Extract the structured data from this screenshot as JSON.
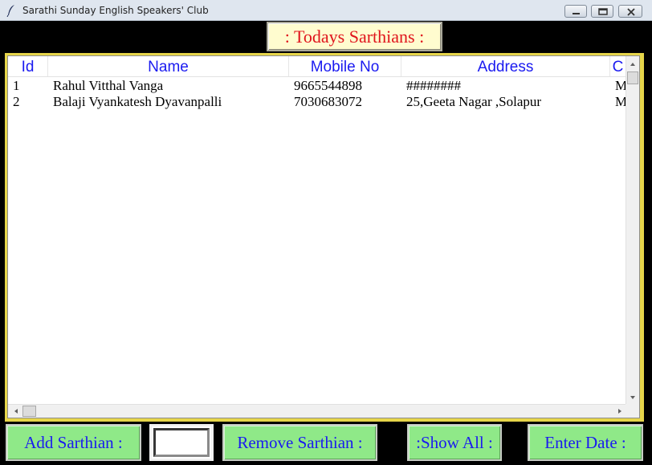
{
  "window": {
    "title": "Sarathi Sunday English Speakers' Club",
    "app_icon": "feather-icon",
    "controls": [
      "minimize-icon",
      "maximize-icon",
      "close-icon"
    ]
  },
  "header": {
    "title": ": Todays Sarthians :"
  },
  "table": {
    "columns": {
      "id": "Id",
      "name": "Name",
      "mobile": "Mobile No",
      "address": "Address",
      "extra": "C"
    },
    "rows": [
      {
        "id": "1",
        "name": "Rahul Vitthal Vanga",
        "mobile": "9665544898",
        "address": "########",
        "extra": "M"
      },
      {
        "id": "2",
        "name": "Balaji Vyankatesh Dyavanpalli",
        "mobile": "7030683072",
        "address": "25,Geeta Nagar ,Solapur",
        "extra": "M"
      }
    ]
  },
  "footer": {
    "add_label": "Add Sarthian :",
    "entry_value": "",
    "remove_label": "Remove Sarthian :",
    "show_all_label": ":Show All :",
    "enter_date_label": "Enter Date :"
  },
  "colors": {
    "header_bg": "#fffccf",
    "header_text": "#e0141c",
    "column_header_text": "#1a1af0",
    "panel_border": "#e6d54a",
    "button_bg": "#8fe988",
    "button_text": "#1a1af0"
  }
}
